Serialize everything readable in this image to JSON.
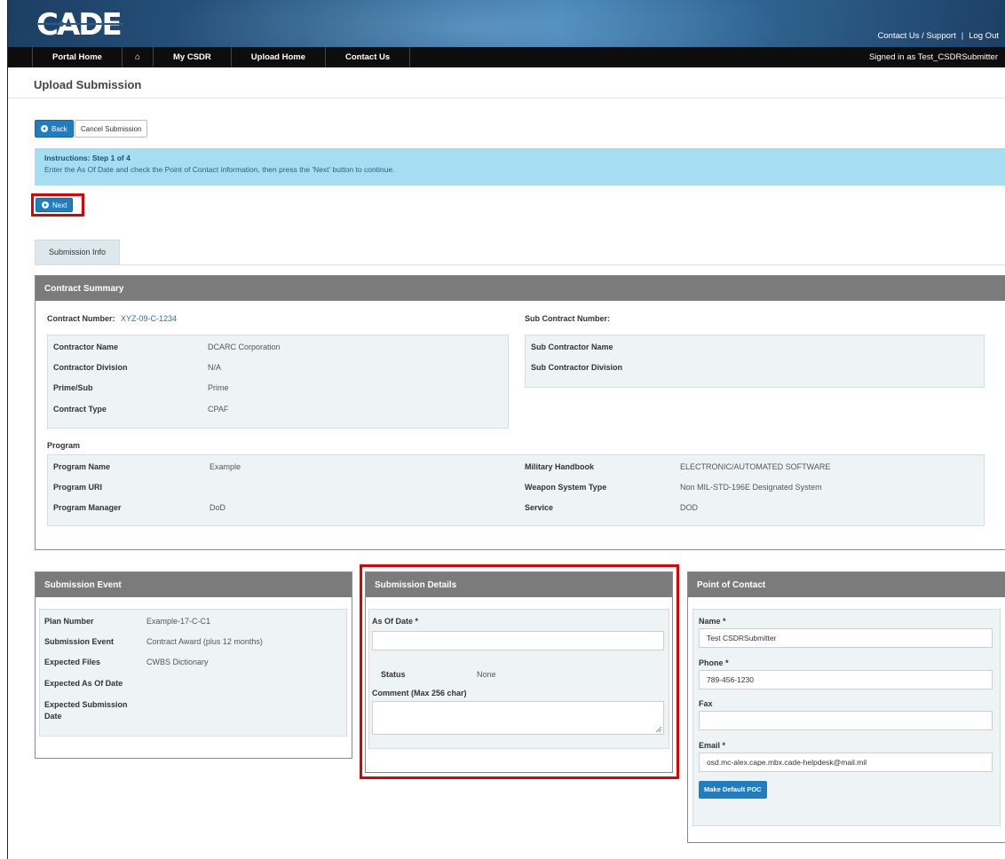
{
  "header": {
    "logo_text": "CADE",
    "links": {
      "contact": "Contact Us / Support",
      "separator": "|",
      "logout": "Log Out"
    }
  },
  "nav": {
    "items": [
      "Portal Home",
      "⌂",
      "My CSDR",
      "Upload Home",
      "Contact Us"
    ],
    "signed_in": "Signed in as Test_CSDRSubmitter"
  },
  "page": {
    "title": "Upload Submission",
    "back_label": "Back",
    "cancel_label": "Cancel Submission",
    "instructions_title": "Instructions: Step 1 of 4",
    "instructions_text": "Enter the As Of Date and check the Point of Contact information, then press the 'Next' button to continue.",
    "next_label": "Next",
    "tab_label": "Submission Info"
  },
  "contract_summary": {
    "header": "Contract Summary",
    "contract_number_label": "Contract Number:",
    "contract_number": "XYZ-09-C-1234",
    "sub_contract_number_label": "Sub Contract Number:",
    "contractor": [
      {
        "label": "Contractor Name",
        "value": "DCARC Corporation"
      },
      {
        "label": "Contractor Division",
        "value": "N/A"
      },
      {
        "label": "Prime/Sub",
        "value": "Prime"
      },
      {
        "label": "Contract Type",
        "value": "CPAF"
      }
    ],
    "subcontractor": [
      {
        "label": "Sub Contractor Name",
        "value": ""
      },
      {
        "label": "Sub Contractor Division",
        "value": ""
      }
    ],
    "program_label": "Program",
    "program_left": [
      {
        "label": "Program Name",
        "value": "Example"
      },
      {
        "label": "Program URI",
        "value": ""
      },
      {
        "label": "Program Manager",
        "value": "DoD"
      }
    ],
    "program_right": [
      {
        "label": "Military Handbook",
        "value": "ELECTRONIC/AUTOMATED SOFTWARE"
      },
      {
        "label": "Weapon System Type",
        "value": "Non MIL-STD-196E Designated System"
      },
      {
        "label": "Service",
        "value": "DOD"
      }
    ]
  },
  "submission_event": {
    "header": "Submission Event",
    "rows": [
      {
        "label": "Plan Number",
        "value": "Example-17-C-C1"
      },
      {
        "label": "Submission Event",
        "value": "Contract Award (plus 12 months)"
      },
      {
        "label": "Expected Files",
        "value": "CWBS Dictionary"
      },
      {
        "label": "Expected As Of Date",
        "value": ""
      },
      {
        "label": "Expected Submission Date",
        "value": ""
      }
    ]
  },
  "submission_details": {
    "header": "Submission Details",
    "as_of_label": "As Of Date *",
    "as_of_value": "",
    "status_label": "Status",
    "status_value": "None",
    "comment_label": "Comment (Max 256 char)",
    "comment_value": ""
  },
  "point_of_contact": {
    "header": "Point of Contact",
    "name_label": "Name *",
    "name_value": "Test CSDRSubmitter",
    "phone_label": "Phone *",
    "phone_value": "789-456-1230",
    "fax_label": "Fax",
    "fax_value": "",
    "email_label": "Email *",
    "email_value": "osd.mc-alex.cape.mbx.cade-helpdesk@mail.mil",
    "default_button": "Make Default POC"
  },
  "colors": {
    "accent": "#1f7dc0",
    "highlight": "#e00000",
    "panel_header": "#7b7b7b",
    "instructions_bg": "#a7ddf2"
  }
}
